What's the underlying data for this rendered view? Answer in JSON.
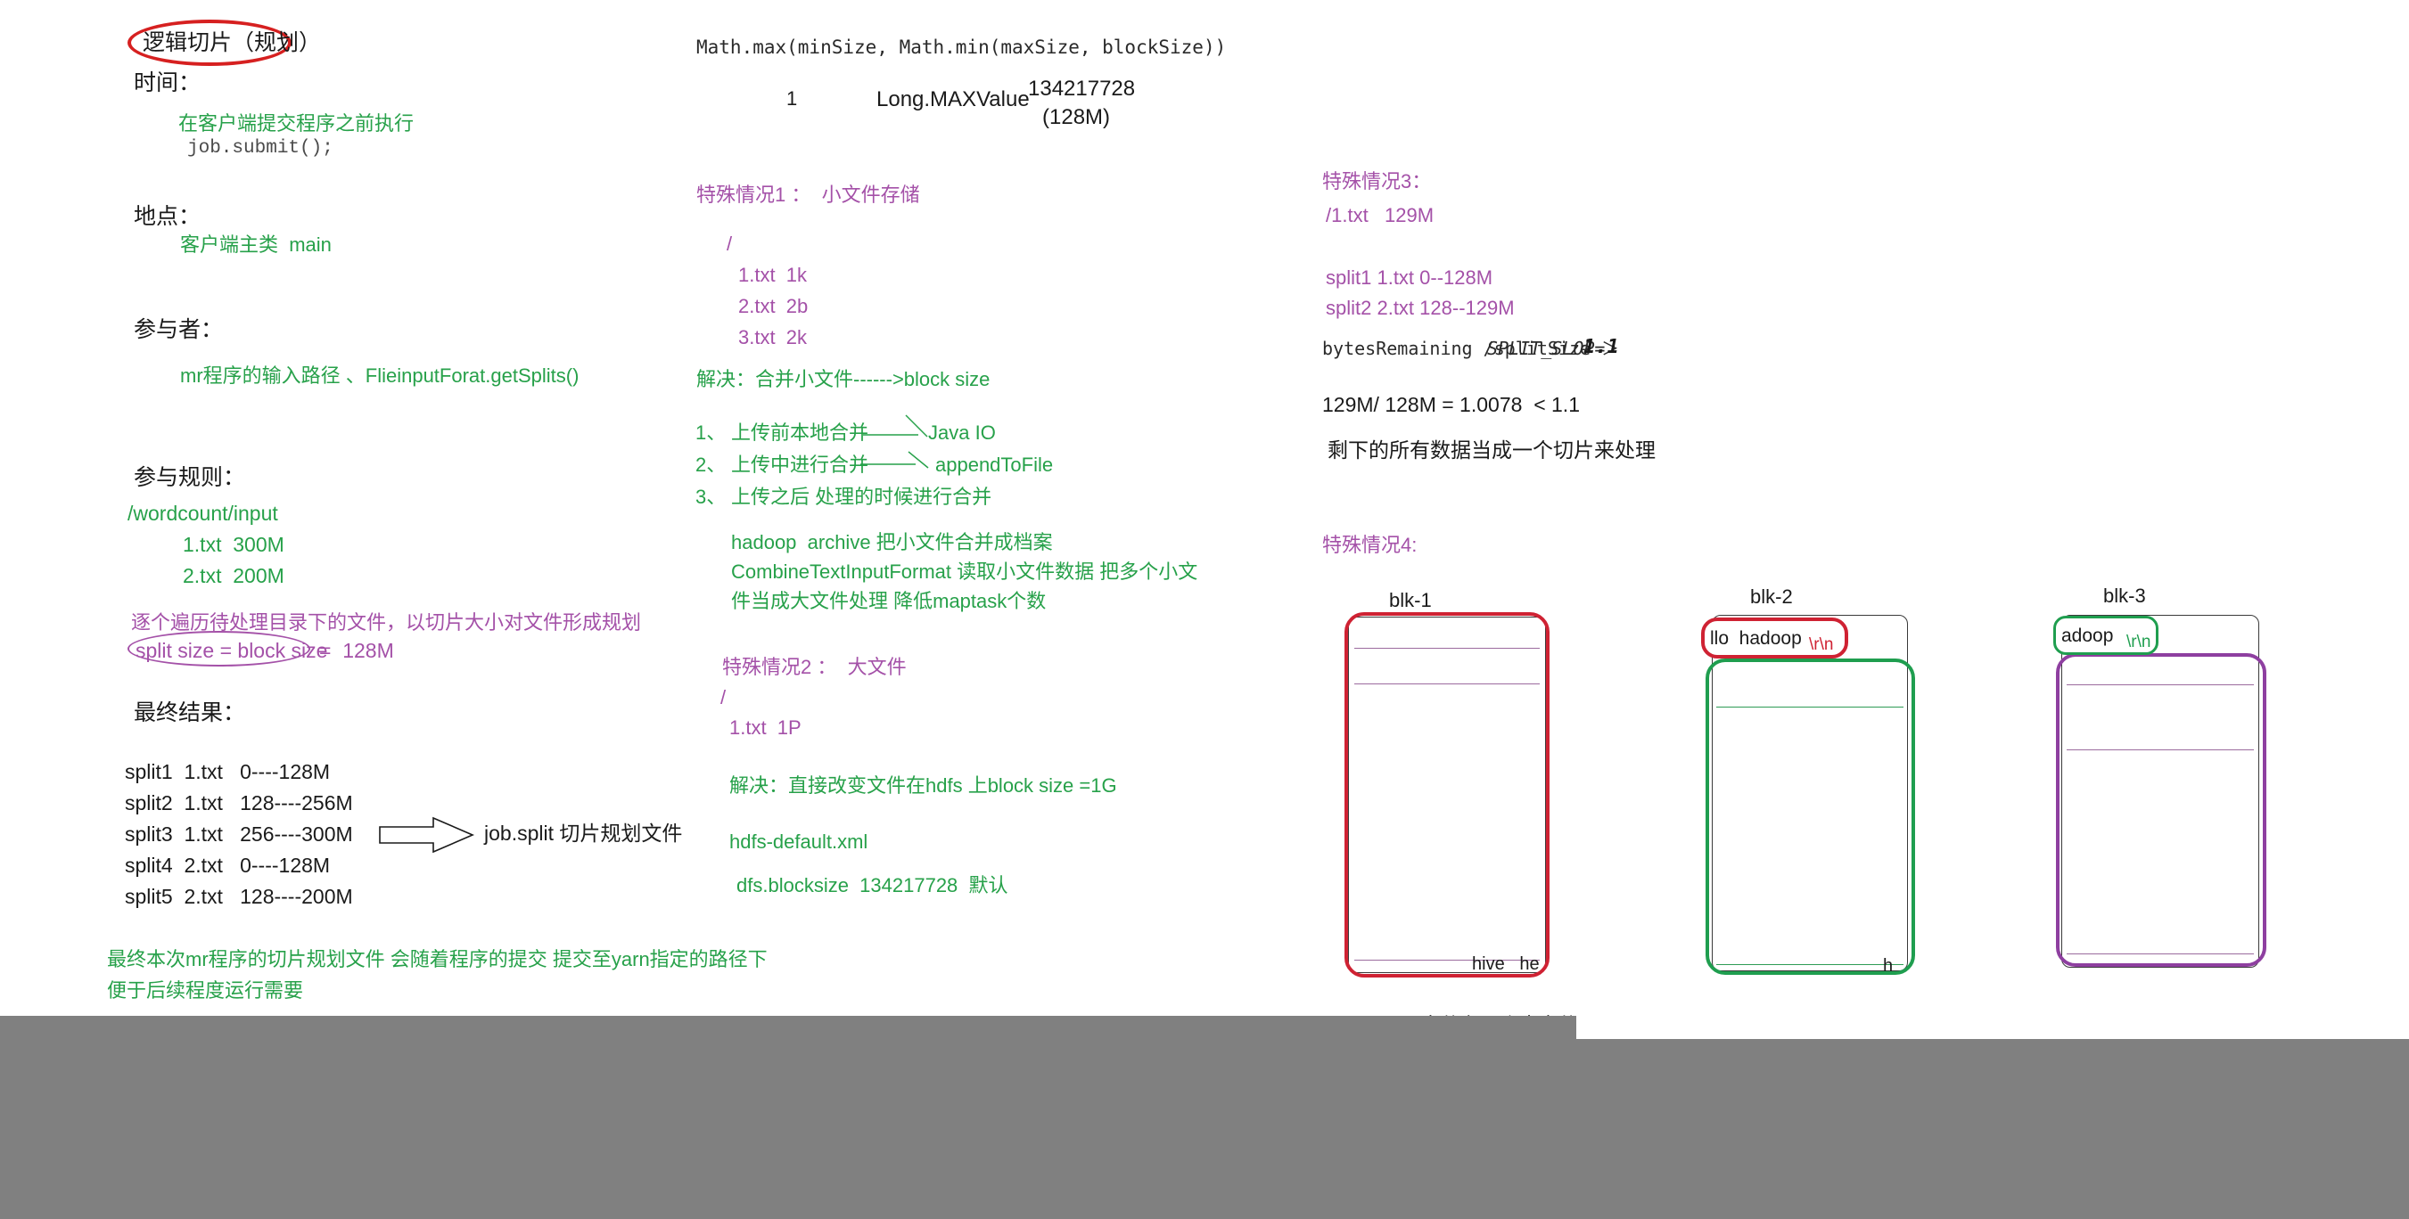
{
  "left_column": {
    "title": "逻辑切片（规划）",
    "time_label": "时间：",
    "time_value_cn": "在客户端提交程序之前执行",
    "time_value_code": "job.submit();",
    "place_label": "地点：",
    "place_value": "客户端主类  main",
    "participants_label": "参与者：",
    "participants_value": "mr程序的输入路径 、FlieinputForat.getSplits()",
    "rules_label": "参与规则：",
    "input_path": "/wordcount/input",
    "input_files": [
      "1.txt  300M",
      "2.txt  200M"
    ],
    "traverse_note": "逐个遍历待处理目录下的文件，以切片大小对文件形成规划",
    "split_formula_boxed": "split size = block size",
    "split_formula_tail": "=  128M",
    "result_label": "最终结果：",
    "splits": [
      "split1  1.txt   0----128M",
      "split2  1.txt   128----256M",
      "split3  1.txt   256----300M",
      "split4  2.txt   0----128M",
      "split5  2.txt   128----200M"
    ],
    "arrow_target": "job.split 切片规划文件",
    "footer_line1": "最终本次mr程序的切片规划文件 会随着程序的提交 提交至yarn指定的路径下",
    "footer_line2": "便于后续程度运行需要"
  },
  "middle_column": {
    "formula": "Math.max(minSize, Math.min(maxSize, blockSize))",
    "formula_v1": "1",
    "formula_v2": "Long.MAXValue",
    "formula_v3_line1": "134217728",
    "formula_v3_line2": "(128M)",
    "case1_title": "特殊情况1 ：  小文件存储",
    "case1_root": "/",
    "case1_files": [
      "1.txt  1k",
      "2.txt  2b",
      "3.txt  2k"
    ],
    "case1_solution": "解决：合并小文件------>block size",
    "case1_steps": [
      {
        "num": "1、",
        "text": "上传前本地合并",
        "target": "Java IO"
      },
      {
        "num": "2、",
        "text": "上传中进行合并",
        "target": "appendToFile"
      },
      {
        "num": "3、",
        "text": "上传之后 处理的时候进行合并",
        "target": ""
      }
    ],
    "case1_notes": [
      "hadoop  archive 把小文件合并成档案",
      "CombineTextInputFormat 读取小文件数据 把多个小文",
      "件当成大文件处理 降低maptask个数"
    ],
    "case2_title": "特殊情况2 ：  大文件",
    "case2_root": "/",
    "case2_file": "1.txt  1P",
    "case2_solution": "解决：直接改变文件在hdfs 上block size =1G",
    "case2_config_file": "hdfs-default.xml",
    "case2_config_entry": "dfs.blocksize  134217728  默认"
  },
  "right_column": {
    "case3_title": "特殊情况3：",
    "case3_file": "/1.txt   129M",
    "case3_splits": [
      "split1 1.txt 0--128M",
      "split2 2.txt 128--129M"
    ],
    "case3_condition_prefix": "bytesRemaining /splitSize ＞ ",
    "case3_condition_const": "SPLIT_SLOP=",
    "case3_condition_value": "1.1",
    "case3_calc": "129M/ 128M = 1.0078  < 1.1",
    "case3_note": "剩下的所有数据当成一个切片来处理",
    "case4_title": "特殊情况4:",
    "blocks": [
      {
        "label": "blk-1",
        "tail_text": "hive   he",
        "highlight": "red"
      },
      {
        "label": "blk-2",
        "tag_text": "llo  hadoop",
        "tag_crlf": "\\r\\n",
        "tail_text": "h",
        "highlight": "green"
      },
      {
        "label": "blk-3",
        "tag_text": "adoop",
        "tag_crlf": "\\r\\n",
        "highlight": "purple"
      }
    ],
    "bottom_partial_text": "文件有几个大文件"
  },
  "colors": {
    "black": "#1a1a1a",
    "green": "#27a14a",
    "purple": "#a451a8",
    "red_annotation": "#d62020",
    "block_red": "#cf2233",
    "block_green": "#1f9e4f",
    "block_purple": "#8e3fa0",
    "gray_bar": "#808080"
  }
}
